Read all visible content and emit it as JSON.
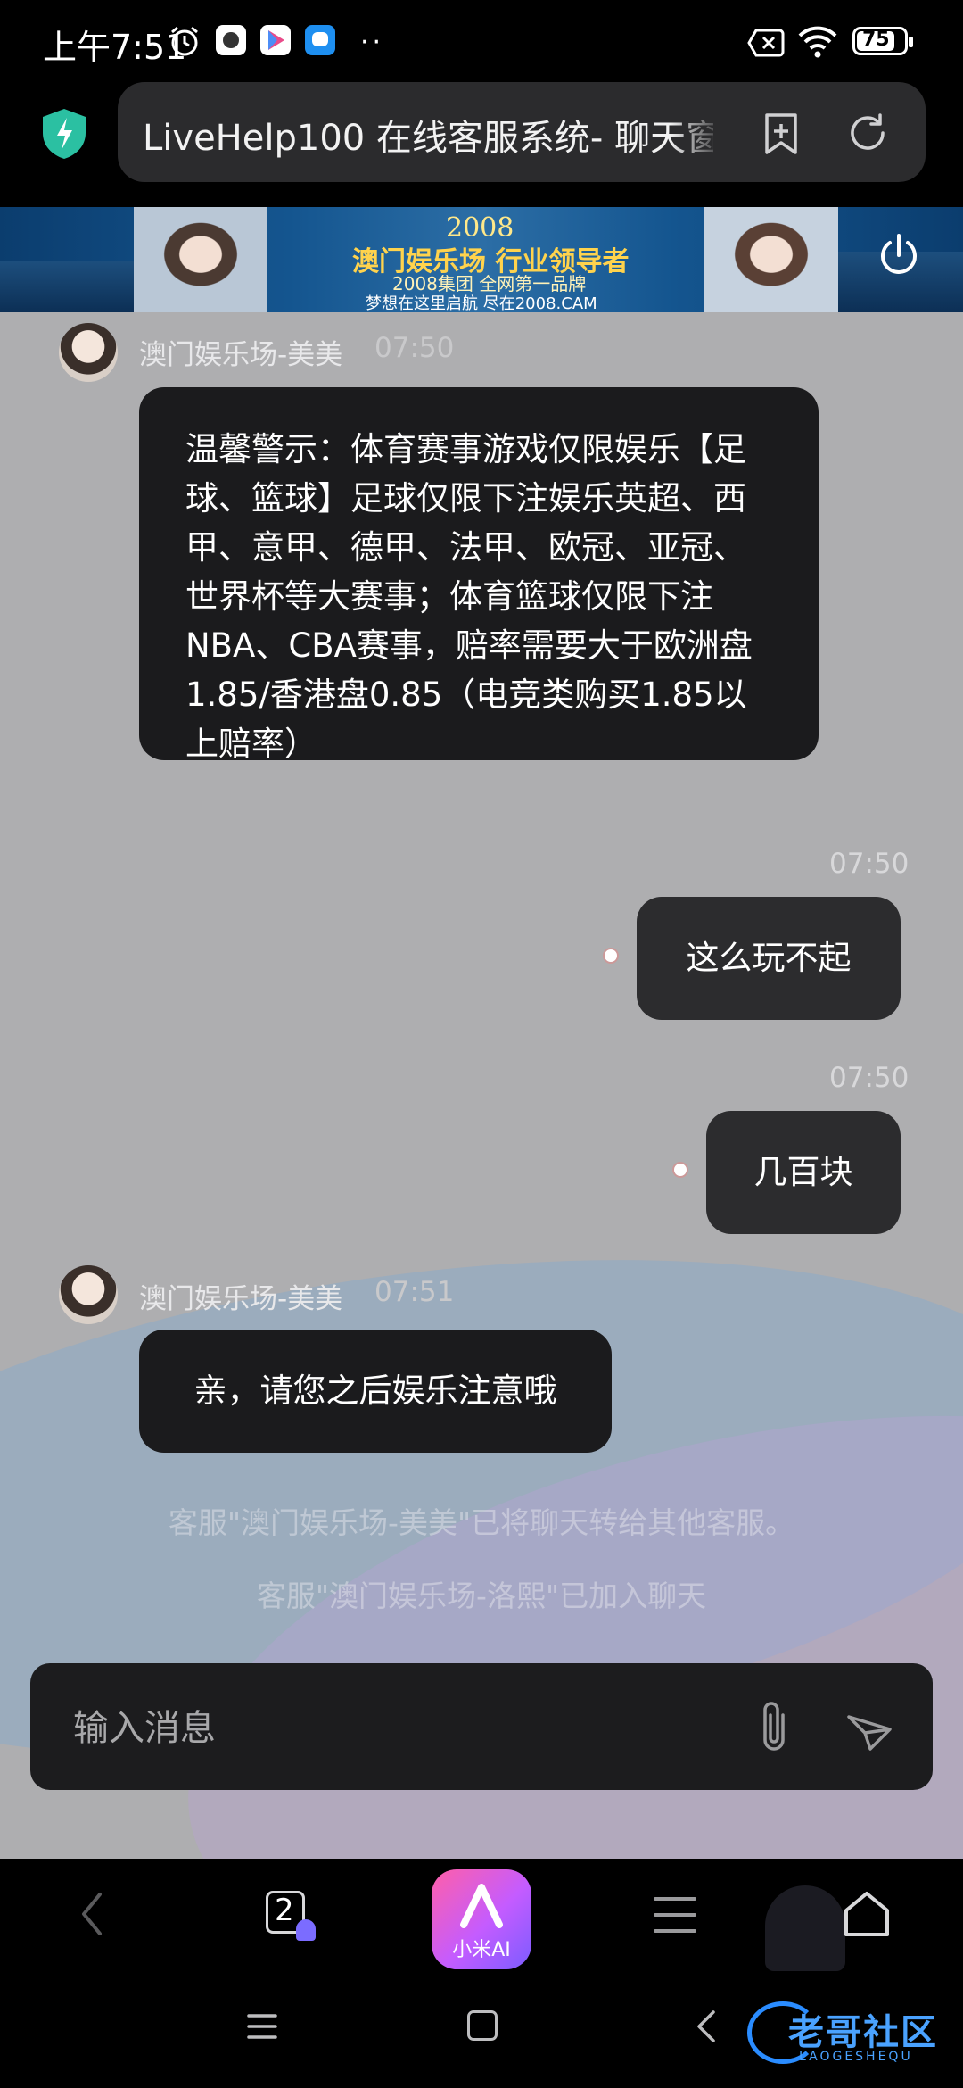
{
  "status_bar": {
    "time": "上午7:51",
    "battery": "75"
  },
  "address_bar": {
    "title": "LiveHelp100 在线客服系统- 聊天窗"
  },
  "banner": {
    "line1": "2008",
    "line2": "澳门娱乐场 行业领导者",
    "line3": "2008集团 全网第一品牌",
    "line4": "梦想在这里启航 尽在2008.CAM"
  },
  "chat": {
    "messages": [
      {
        "sender": "澳门娱乐场-美美",
        "time": "07:50",
        "text": "温馨警示：体育赛事游戏仅限娱乐【足球、篮球】足球仅限下注娱乐英超、西甲、意甲、德甲、法甲、欧冠、亚冠、世界杯等大赛事；体育篮球仅限下注NBA、CBA赛事，赔率需要大于欧洲盘1.85/香港盘0.85（电竞类购买1.85以上赔率）"
      },
      {
        "time": "07:50",
        "text": "这么玩不起"
      },
      {
        "time": "07:50",
        "text": "几百块"
      },
      {
        "sender": "澳门娱乐场-美美",
        "time": "07:51",
        "text": "亲，请您之后娱乐注意哦"
      }
    ],
    "system_notes": [
      "客服\"澳门娱乐场-美美\"已将聊天转给其他客服。",
      "客服\"澳门娱乐场-洛熙\"已加入聊天"
    ]
  },
  "input": {
    "placeholder": "输入消息"
  },
  "toolbar": {
    "tabs_count": "2",
    "ai_label": "小米AI"
  },
  "watermark": {
    "text": "老哥社区",
    "sub": "LAOGESHEQU"
  },
  "colors": {
    "chat_bg": "#aeaeb0",
    "bubble_in": "#1b1b1d",
    "bubble_out": "#2c2c2e",
    "ai_gradient_start": "#ff5fa8",
    "ai_gradient_end": "#7b5cff"
  },
  "icons": [
    "alarm-icon",
    "app-icon",
    "play-store-icon",
    "message-app-icon",
    "more-dots-icon",
    "sim-off-icon",
    "wifi-icon",
    "battery-icon",
    "shield-icon",
    "bookmark-add-icon",
    "refresh-icon",
    "power-icon",
    "attach-icon",
    "send-icon",
    "back-icon",
    "tabs-icon",
    "menu-icon",
    "home-icon"
  ]
}
